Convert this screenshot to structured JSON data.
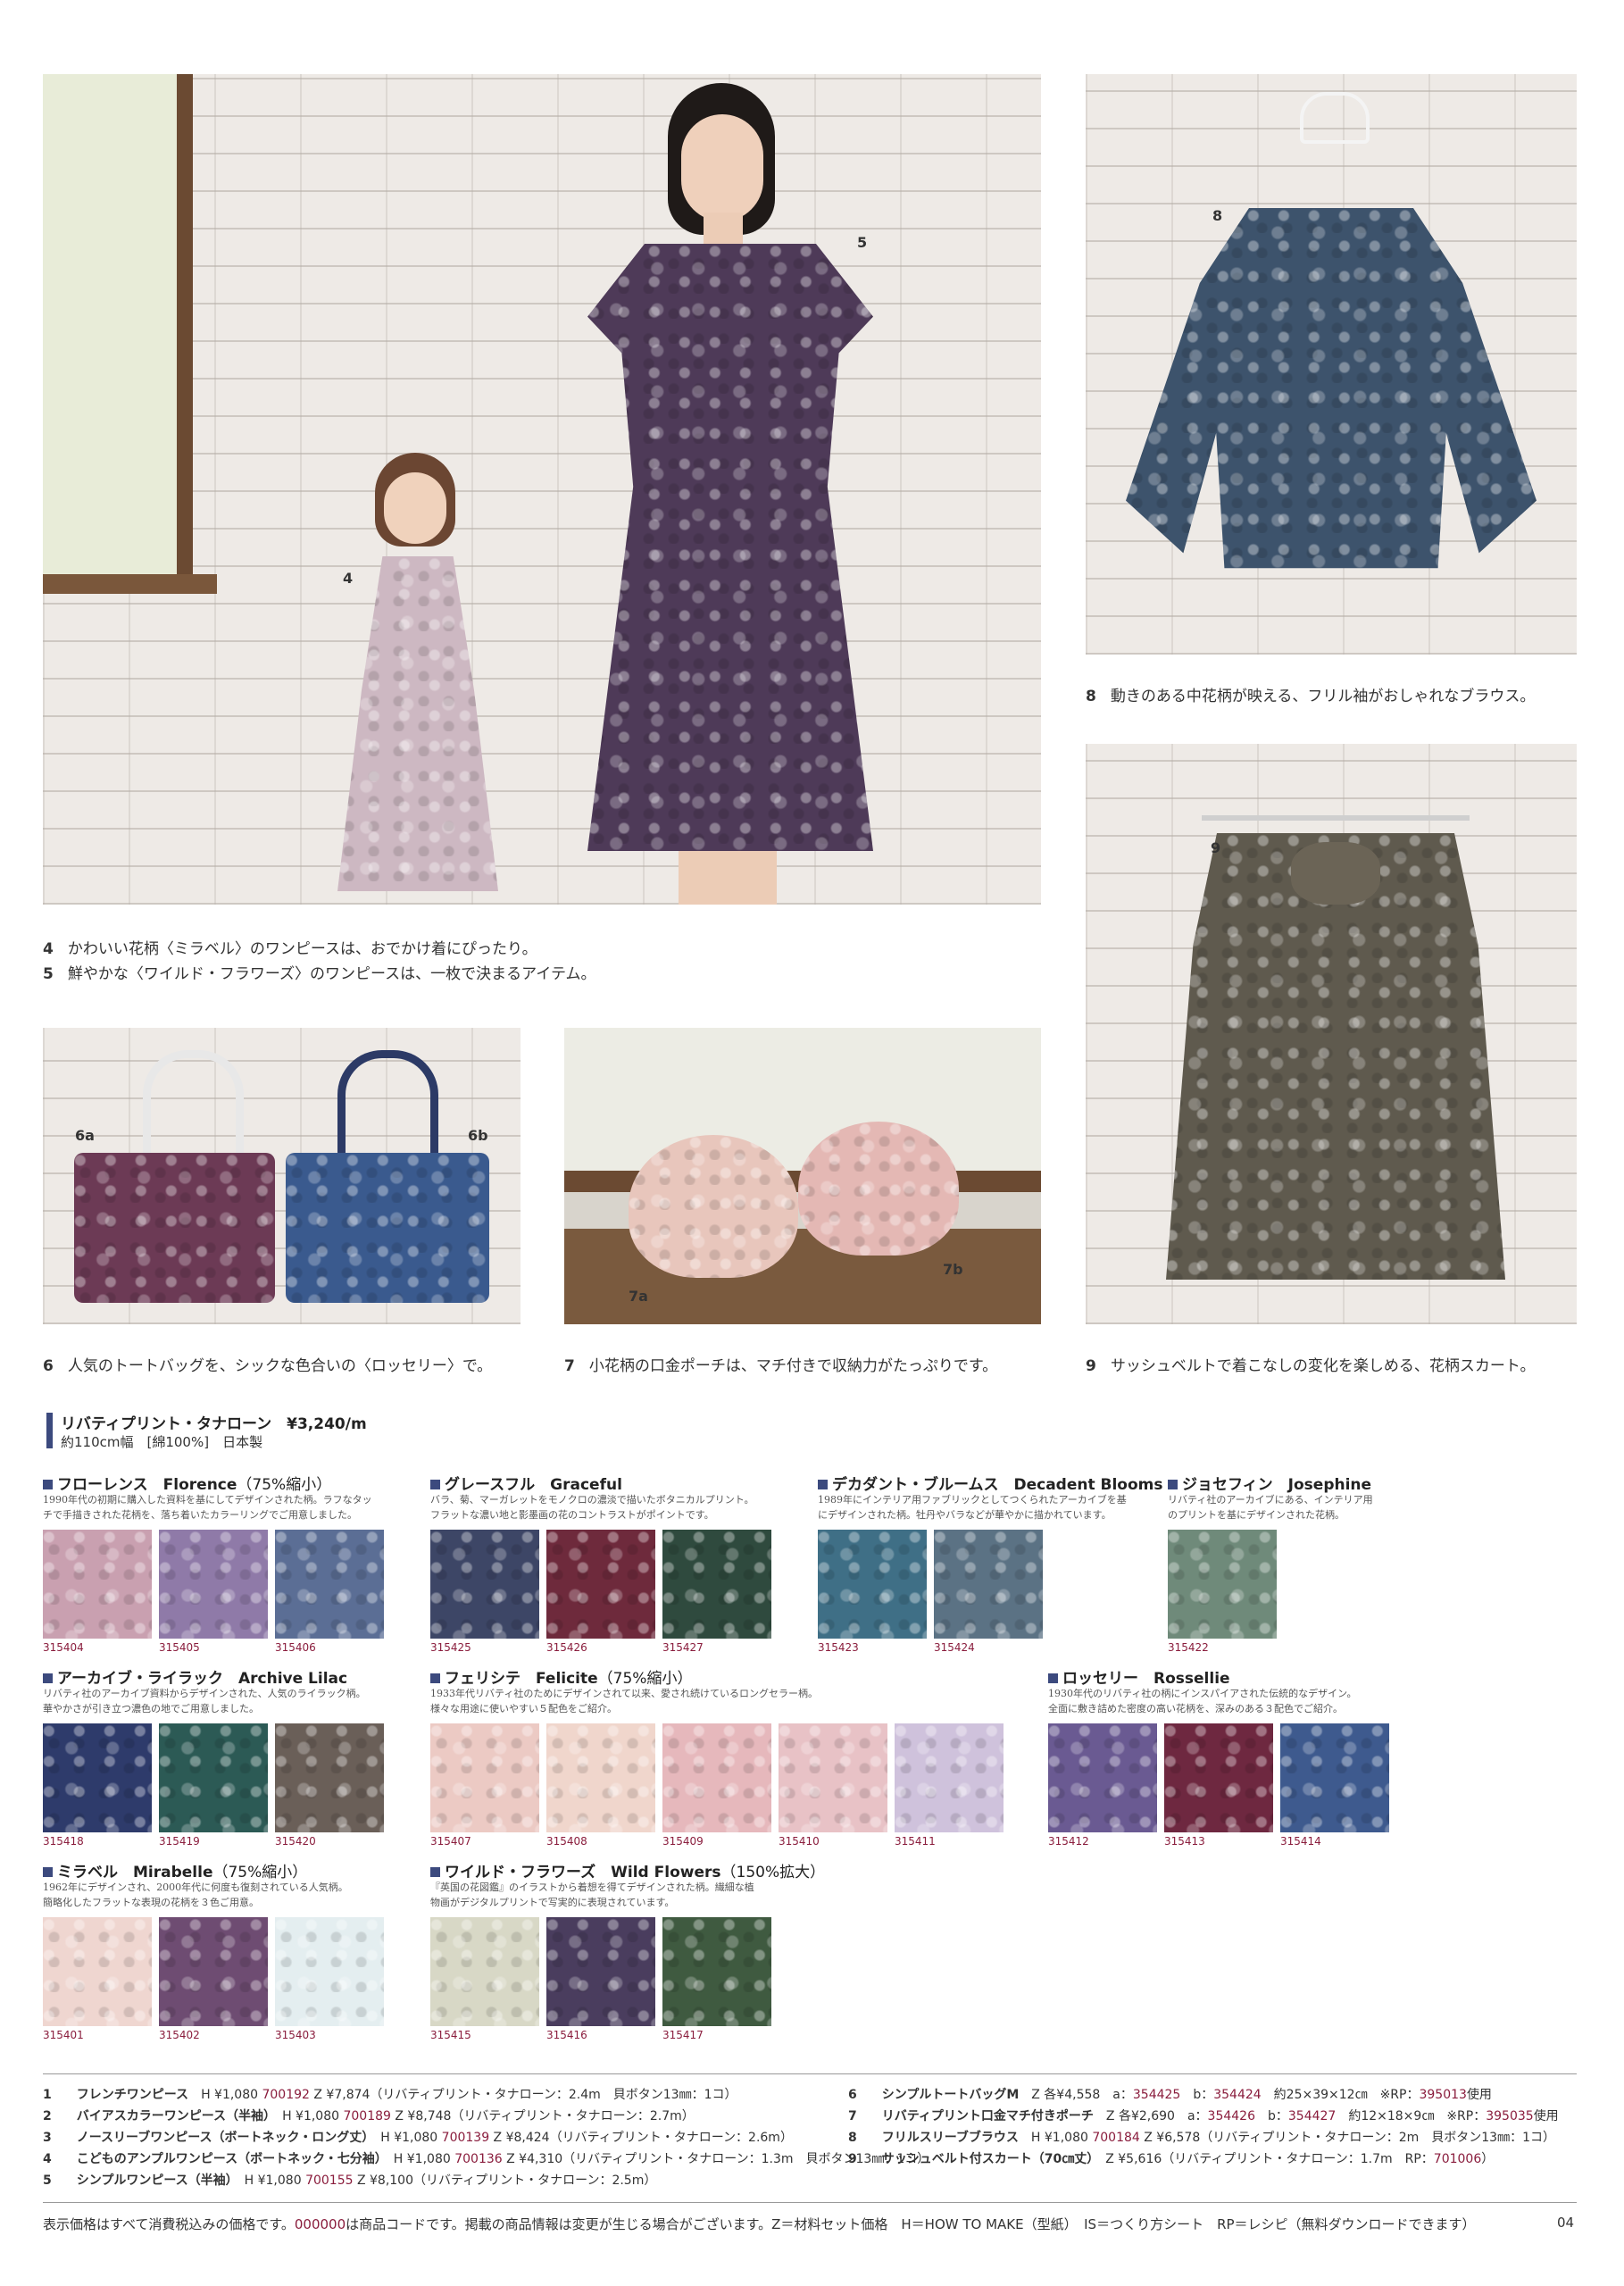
{
  "photos": {
    "labels": [
      "4",
      "5",
      "8",
      "9",
      "6a",
      "6b",
      "7a",
      "7b"
    ]
  },
  "captions": {
    "c4": {
      "num": "4",
      "text": "かわいい花柄〈ミラベル〉のワンピースは、おでかけ着にぴったり。"
    },
    "c5": {
      "num": "5",
      "text": "鮮やかな〈ワイルド・フラワーズ〉のワンピースは、一枚で決まるアイテム。"
    },
    "c8": {
      "num": "8",
      "text": "動きのある中花柄が映える、フリル袖がおしゃれなブラウス。"
    },
    "c6": {
      "num": "6",
      "text": "人気のトートバッグを、シックな色合いの〈ロッセリー〉で。"
    },
    "c7": {
      "num": "7",
      "text": "小花柄の口金ポーチは、マチ付きで収納力がたっぷりです。"
    },
    "c9": {
      "num": "9",
      "text": "サッシュベルトで着こなしの変化を楽しめる、花柄スカート。"
    }
  },
  "fabric": {
    "title": "リバティプリント・タナローン　¥3,240/m",
    "subtitle": "約110cm幅　[綿100%]　日本製"
  },
  "patterns": [
    {
      "name": "フローレンス　Florence",
      "pct": "（75%縮小）",
      "desc": [
        "1990年代の初期に購入した資料を基にしてデザインされた柄。ラフなタッ",
        "チで手描きされた花柄を、落ち着いたカラーリングでご用意しました。"
      ],
      "swatches": [
        {
          "code": "315404",
          "color": "#c9a0b0"
        },
        {
          "code": "315405",
          "color": "#8f7aa8"
        },
        {
          "code": "315406",
          "color": "#5b6e95"
        }
      ]
    },
    {
      "name": "グレースフル　Graceful",
      "pct": "",
      "desc": [
        "バラ、菊、マーガレットをモノクロの濃淡で描いたボタニカルプリント。",
        "フラットな濃い地と影墨画の花のコントラストがポイントです。"
      ],
      "swatches": [
        {
          "code": "315425",
          "color": "#3d4666"
        },
        {
          "code": "315426",
          "color": "#6e2a3c"
        },
        {
          "code": "315427",
          "color": "#2f4a3e"
        }
      ]
    },
    {
      "name": "デカダント・ブルームス　Decadent Blooms",
      "pct": "",
      "desc": [
        "1989年にインテリア用ファブリックとしてつくられたアーカイブを基",
        "にデザインされた柄。牡丹やバラなどが華やかに描かれています。"
      ],
      "swatches": [
        {
          "code": "315423",
          "color": "#3f6f86"
        },
        {
          "code": "315424",
          "color": "#5b7284"
        }
      ]
    },
    {
      "name": "ジョセフィン　Josephine",
      "pct": "",
      "desc": [
        "リバティ社のアーカイブにある、インテリア用",
        "のプリントを基にデザインされた花柄。"
      ],
      "swatches": [
        {
          "code": "315422",
          "color": "#6f8a7a"
        }
      ]
    },
    {
      "name": "アーカイブ・ライラック　Archive Lilac",
      "pct": "",
      "desc": [
        "リバティ社のアーカイブ資料からデザインされた、人気のライラック柄。",
        "華やかさが引き立つ濃色の地でご用意しました。"
      ],
      "swatches": [
        {
          "code": "315418",
          "color": "#2e3b6b"
        },
        {
          "code": "315419",
          "color": "#2c5a55"
        },
        {
          "code": "315420",
          "color": "#6a5f58"
        }
      ]
    },
    {
      "name": "フェリシテ　Felicite",
      "pct": "（75%縮小）",
      "desc": [
        "1933年代リバティ社のためにデザインされて以来、愛され続けているロングセラー柄。",
        "様々な用途に使いやすい５配色をご紹介。"
      ],
      "swatches": [
        {
          "code": "315407",
          "color": "#eccac4"
        },
        {
          "code": "315408",
          "color": "#f0d6cc"
        },
        {
          "code": "315409",
          "color": "#e6b8bc"
        },
        {
          "code": "315410",
          "color": "#e8c2c6"
        },
        {
          "code": "315411",
          "color": "#cfc2dc"
        }
      ]
    },
    {
      "name": "ロッセリー　Rossellie",
      "pct": "",
      "desc": [
        "1930年代のリバティ社の柄にインスパイアされた伝統的なデザイン。",
        "全面に敷き詰めた密度の高い花柄を、深みのある３配色でご紹介。"
      ],
      "swatches": [
        {
          "code": "315412",
          "color": "#6a5a92"
        },
        {
          "code": "315413",
          "color": "#6e2840"
        },
        {
          "code": "315414",
          "color": "#3e5a8e"
        }
      ]
    },
    {
      "name": "ミラベル　Mirabelle",
      "pct": "（75%縮小）",
      "desc": [
        "1962年にデザインされ、2000年代に何度も復刻されている人気柄。",
        "簡略化したフラットな表現の花柄を３色ご用意。"
      ],
      "swatches": [
        {
          "code": "315401",
          "color": "#efd6d0"
        },
        {
          "code": "315402",
          "color": "#6e4c72"
        },
        {
          "code": "315403",
          "color": "#e4eef0"
        }
      ]
    },
    {
      "name": "ワイルド・フラワーズ　Wild Flowers",
      "pct": "（150%拡大）",
      "desc": [
        "『英国の花図鑑』のイラストから着想を得てデザインされた柄。繊細な植",
        "物画がデジタルプリントで写実的に表現されています。"
      ],
      "swatches": [
        {
          "code": "315415",
          "color": "#d8d8c6"
        },
        {
          "code": "315416",
          "color": "#4a3d5e"
        },
        {
          "code": "315417",
          "color": "#3f5a40"
        }
      ]
    }
  ],
  "specs_left": [
    {
      "n": "1",
      "name": "フレンチワンピース",
      "rest_a": "H ¥1,080 ",
      "code": "700192",
      "rest_b": " Z ¥7,874（リバティプリント・タナローン：2.4m　貝ボタン13㎜：1コ）"
    },
    {
      "n": "2",
      "name": "バイアスカラーワンピース（半袖）",
      "rest_a": "H ¥1,080 ",
      "code": "700189",
      "rest_b": " Z ¥8,748（リバティプリント・タナローン：2.7m）"
    },
    {
      "n": "3",
      "name": "ノースリーブワンピース（ボートネック・ロング丈）",
      "rest_a": "H ¥1,080 ",
      "code": "700139",
      "rest_b": " Z ¥8,424（リバティプリント・タナローン：2.6m）"
    },
    {
      "n": "4",
      "name": "こどものアンプルワンピース（ボートネック・七分袖）",
      "rest_a": "H ¥1,080 ",
      "code": "700136",
      "rest_b": " Z ¥4,310（リバティプリント・タナローン：1.3m　貝ボタン13㎜：1コ）"
    },
    {
      "n": "5",
      "name": "シンプルワンピース（半袖）",
      "rest_a": "H ¥1,080 ",
      "code": "700155",
      "rest_b": " Z ¥8,100（リバティプリント・タナローン：2.5m）"
    }
  ],
  "specs_right": [
    {
      "n": "6",
      "name": "シンプルトートバッグM",
      "text": "Z 各¥4,558　a：",
      "c1": "354425",
      "mid": "　b：",
      "c2": "354424",
      "tail": "　約25×39×12㎝　※RP：",
      "c3": "395013",
      "end": "使用"
    },
    {
      "n": "7",
      "name": "リバティプリント口金マチ付きポーチ",
      "text": "Z 各¥2,690　a：",
      "c1": "354426",
      "mid": "　b：",
      "c2": "354427",
      "tail": "　約12×18×9㎝　※RP：",
      "c3": "395035",
      "end": "使用"
    },
    {
      "n": "8",
      "name": "フリルスリーブブラウス",
      "text": "H ¥1,080 ",
      "c1": "700184",
      "mid": " Z ¥6,578（リバティプリント・タナローン：2m　貝ボタン13㎜：1コ）",
      "c2": "",
      "tail": "",
      "c3": "",
      "end": ""
    },
    {
      "n": "9",
      "name": "サッシュベルト付スカート（70㎝丈）",
      "text": "Z ¥5,616（リバティプリント・タナローン：1.7m　RP：",
      "c1": "701006",
      "mid": "）",
      "c2": "",
      "tail": "",
      "c3": "",
      "end": ""
    }
  ],
  "footer": {
    "note_a": "表示価格はすべて消費税込みの価格です。",
    "code_sample": "000000",
    "note_b": "は商品コードです。掲載の商品情報は変更が生じる場合がございます。Z＝材料セット価格　H＝HOW TO MAKE（型紙）　IS＝つくり方シート　RP＝レシピ（無料ダウンロードできます）",
    "page": "04"
  },
  "colors": {
    "accent": "#3c4a7e",
    "code_red": "#8a1d3d"
  }
}
